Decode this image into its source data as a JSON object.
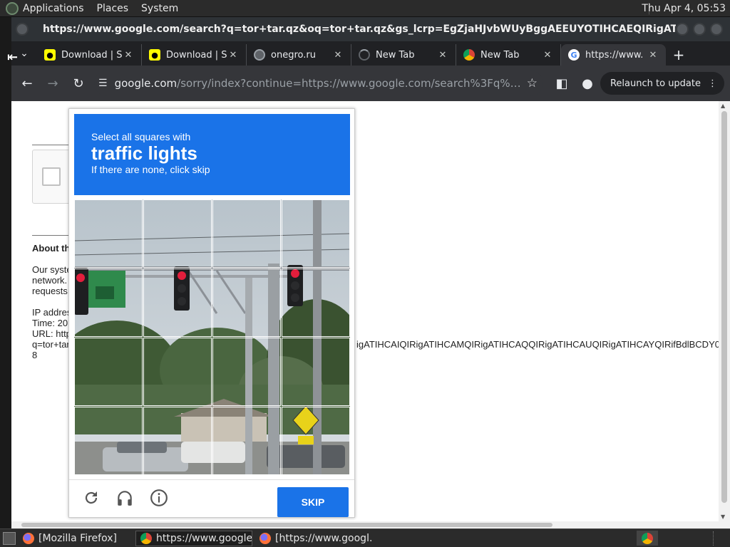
{
  "panel": {
    "menus": [
      "Applications",
      "Places",
      "System"
    ],
    "clock": "Thu Apr  4, 05:53"
  },
  "window": {
    "title": "https://www.google.com/search?q=tor+tar.qz&oq=tor+tar.qz&gs_lcrp=EgZjaHJvbWUyBggAEEUYOTIHCAEQIRigATIHCAIQIRigATIHCAMQI..."
  },
  "tabs": [
    {
      "label": "Download | S",
      "favicon": "snapchat-icon",
      "active": false
    },
    {
      "label": "Download | S",
      "favicon": "snapchat-icon",
      "active": false
    },
    {
      "label": "onegro.ru",
      "favicon": "globe-icon",
      "active": false
    },
    {
      "label": "New Tab",
      "favicon": "loading-icon",
      "active": false
    },
    {
      "label": "New Tab",
      "favicon": "chrome-icon",
      "active": false
    },
    {
      "label": "https://www.",
      "favicon": "google-icon",
      "active": true
    }
  ],
  "toolbar": {
    "url_host": "google.com",
    "url_rest": "/sorry/index?continue=https://www.google.com/search%3Fq%3Dtor%2Bta...",
    "relaunch_label": "Relaunch to update"
  },
  "page": {
    "about": "About th",
    "text1": "Our syste",
    "text2": "network.",
    "text3": "requests",
    "ip": "IP addres",
    "time": "Time: 20",
    "url": "URL: http",
    "url2": "q=tor+tar",
    "url_tail": "igATIHCAIQIRigATIHCAMQIRigATIHCAQQIRigATIHCAUQIRigATIHCAYQIRifBdlBCDY0",
    "eight": "8"
  },
  "captcha": {
    "instruction": "Select all squares with",
    "target": "traffic lights",
    "hint": "If there are none, click skip",
    "skip_label": "SKIP",
    "accent": "#1a73e8"
  },
  "taskbar": {
    "items": [
      {
        "label": "[Mozilla Firefox]",
        "icon": "firefox-icon",
        "active": false
      },
      {
        "label": "https://www.google...",
        "icon": "chrome-icon",
        "active": true
      },
      {
        "label": "[https://www.googl...",
        "icon": "firefox-icon",
        "active": false
      }
    ]
  }
}
